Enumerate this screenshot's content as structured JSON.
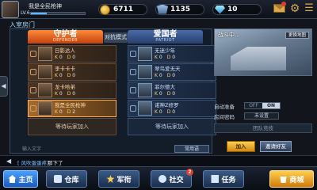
{
  "header": {
    "player_name": "我是全民枪神",
    "level": "LV.6",
    "xp_progress": 0.3,
    "coins": "6711",
    "medals": "1135",
    "gems": "10"
  },
  "room": {
    "title": "入室房门",
    "left_arrow": "◀",
    "defenders": {
      "title": "守护者",
      "subtitle": "DEFENDER",
      "players": [
        {
          "name": "日影达人",
          "kills": "0",
          "deaths": "0"
        },
        {
          "name": "李卡卡卡",
          "kills": "0",
          "deaths": "0"
        },
        {
          "name": "龙卡哈弟",
          "kills": "0",
          "deaths": "0"
        },
        {
          "name": "我是全民枪神",
          "kills": "0",
          "deaths": "2"
        }
      ],
      "invite_label": "等待玩家加入"
    },
    "vs_label": "对抗模式",
    "attackers": {
      "title": "爱国者",
      "subtitle": "PATRIOT",
      "players": [
        {
          "name": "无迷少年",
          "kills": "0",
          "deaths": "0"
        },
        {
          "name": "翠鸟爱无天",
          "kills": "0",
          "deaths": "0"
        },
        {
          "name": "菲尔德大",
          "kills": "0",
          "deaths": "0"
        },
        {
          "name": "诺神Z修罗",
          "kills": "0",
          "deaths": "0"
        }
      ],
      "invite_label": "等待玩家加入"
    },
    "kill_label": "K",
    "death_label": "D",
    "chat_placeholder": "输入文字",
    "common_label": "常用语"
  },
  "map": {
    "name": "战斗中...",
    "change_label": "更换地图"
  },
  "settings": {
    "auto_ready_label": "自动准备",
    "off_label": "OFF",
    "on_label": "ON",
    "room_pwd_label": "房间密码",
    "pwd_value": "未设置",
    "team_join": "团队竞技",
    "join_btn": "加入",
    "invite_btn": "邀请好友"
  },
  "chat": {
    "arrow": "◀",
    "tag": "[ 风吹蛋蛋疼]",
    "message": "那下了"
  },
  "nav": {
    "main": "主页",
    "warehouse": "仓库",
    "rank": "军衔",
    "social": "社交",
    "social_badge": "2",
    "task": "任务",
    "shop": "商城"
  }
}
